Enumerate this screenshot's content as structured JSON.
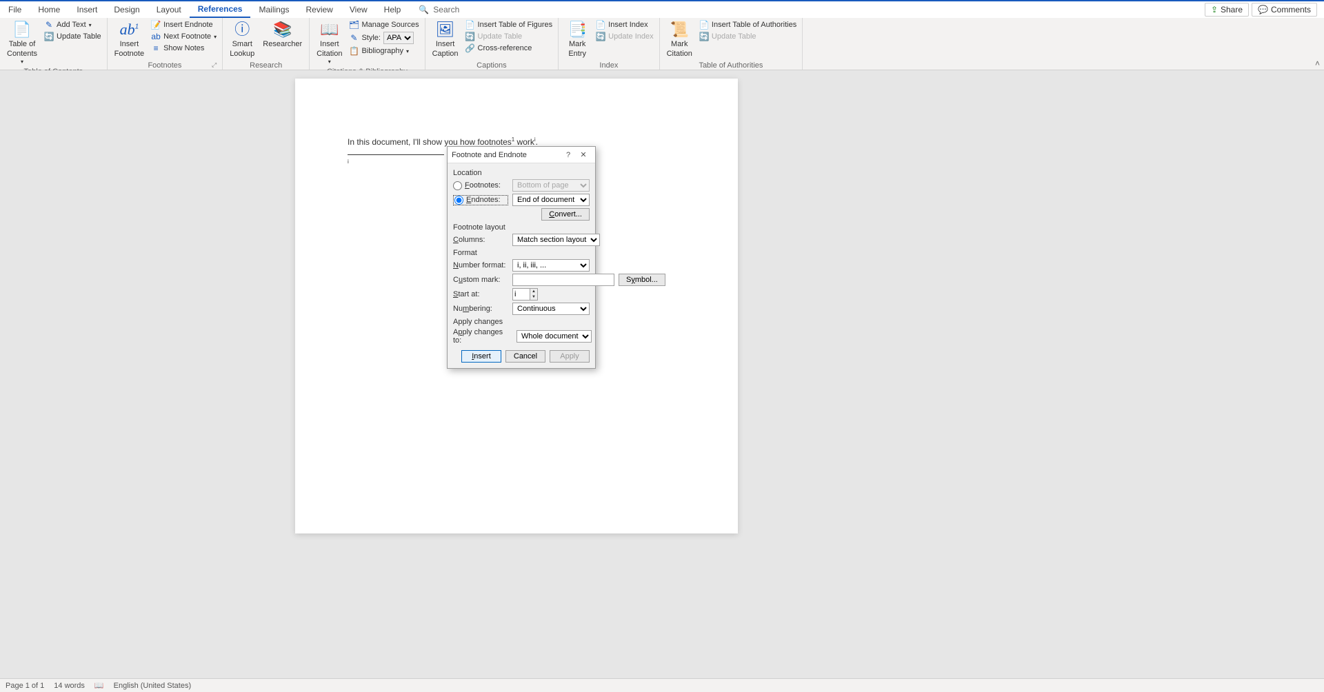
{
  "tabs": [
    "File",
    "Home",
    "Insert",
    "Design",
    "Layout",
    "References",
    "Mailings",
    "Review",
    "View",
    "Help"
  ],
  "active_tab": "References",
  "search_placeholder": "Search",
  "top_actions": {
    "share": "Share",
    "comments": "Comments"
  },
  "ribbon": {
    "toc": {
      "label": "Table of Contents",
      "big": "Table of\nContents",
      "add_text": "Add Text",
      "update_table": "Update Table"
    },
    "footnotes": {
      "label": "Footnotes",
      "big": "Insert\nFootnote",
      "insert_endnote": "Insert Endnote",
      "next_footnote": "Next Footnote",
      "show_notes": "Show Notes"
    },
    "research": {
      "label": "Research",
      "smart_lookup": "Smart\nLookup",
      "researcher": "Researcher"
    },
    "citations": {
      "label": "Citations & Bibliography",
      "big": "Insert\nCitation",
      "manage_sources": "Manage Sources",
      "style_label": "Style:",
      "style_value": "APA",
      "bibliography": "Bibliography"
    },
    "captions": {
      "label": "Captions",
      "big": "Insert\nCaption",
      "insert_tof": "Insert Table of Figures",
      "update_table": "Update Table",
      "cross_ref": "Cross-reference"
    },
    "index": {
      "label": "Index",
      "big": "Mark\nEntry",
      "insert_index": "Insert Index",
      "update_index": "Update Index"
    },
    "authorities": {
      "label": "Table of Authorities",
      "big": "Mark\nCitation",
      "insert_toa": "Insert Table of Authorities",
      "update_table": "Update Table"
    }
  },
  "document": {
    "text_before": "In this document, I'll show you how footnotes",
    "sup1": "1",
    "text_mid": " work",
    "sup2": "i",
    "text_after": ".",
    "footnote_mark": "i"
  },
  "dialog": {
    "title": "Footnote and Endnote",
    "section_location": "Location",
    "footnotes_label": "Footnotes:",
    "footnotes_value": "Bottom of page",
    "endnotes_label": "Endnotes:",
    "endnotes_value": "End of document",
    "convert": "Convert...",
    "section_layout": "Footnote layout",
    "columns_label": "Columns:",
    "columns_value": "Match section layout",
    "section_format": "Format",
    "number_format_label": "Number format:",
    "number_format_value": "i, ii, iii, ...",
    "custom_mark_label": "Custom mark:",
    "custom_mark_value": "",
    "symbol": "Symbol...",
    "start_at_label": "Start at:",
    "start_at_value": "i",
    "numbering_label": "Numbering:",
    "numbering_value": "Continuous",
    "section_apply": "Apply changes",
    "apply_to_label": "Apply changes to:",
    "apply_to_value": "Whole document",
    "insert": "Insert",
    "cancel": "Cancel",
    "apply": "Apply"
  },
  "status": {
    "page": "Page 1 of 1",
    "words": "14 words",
    "language": "English (United States)"
  }
}
